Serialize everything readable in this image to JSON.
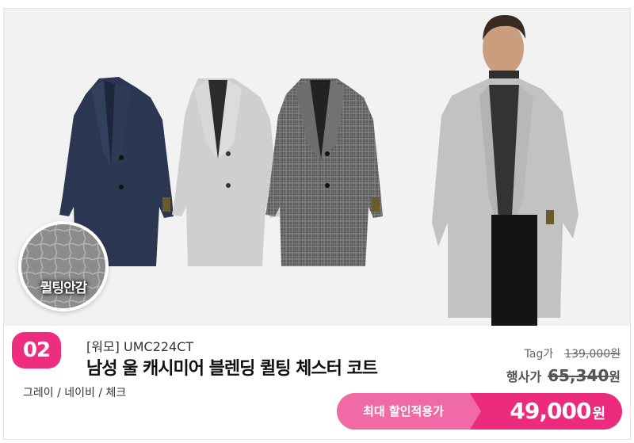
{
  "product": {
    "rank": "02",
    "brand_code": "[워모] UMC224CT",
    "title": "남성 울 캐시미어 블렌딩 퀼팅 체스터 코트",
    "colors": "그레이 / 네이비 /  체크",
    "quilt_badge": "퀼팅안감"
  },
  "pricing": {
    "tag_label": "Tag가",
    "tag_price": "139,000원",
    "event_label": "행사가",
    "event_price": "65,340",
    "event_won": "원",
    "max_label": "최대 할인적용가",
    "max_price": "49,000",
    "max_won": "원"
  },
  "colors": {
    "accent": "#ec2a7e",
    "accent_light": "#f06aa6",
    "navy_coat": "#27334d",
    "gray_coat": "#cfcfcf",
    "check_coat": "#6a6a6a"
  }
}
